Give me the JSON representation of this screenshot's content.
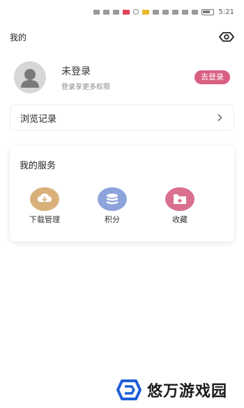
{
  "status_bar": {
    "time": "5:21"
  },
  "header": {
    "title": "我的",
    "eye_icon": "eye-icon"
  },
  "profile": {
    "name": "未登录",
    "subtitle": "登录享更多权限",
    "login_label": "去登录",
    "avatar_icon": "user-avatar-icon"
  },
  "history": {
    "label": "浏览记录",
    "chevron_icon": "chevron-right-icon"
  },
  "services": {
    "title": "我的服务",
    "items": [
      {
        "label": "下载管理",
        "icon": "cloud-download-icon",
        "color": "#d9b07a"
      },
      {
        "label": "积分",
        "icon": "coins-stack-icon",
        "color": "#8da3dc"
      },
      {
        "label": "收藏",
        "icon": "folder-star-icon",
        "color": "#d9708e"
      }
    ]
  },
  "colors": {
    "accent_pink": "#d95f82",
    "download_color": "#d9b07a",
    "points_color": "#8da3dc",
    "favorites_color": "#d9708e"
  },
  "watermark": {
    "text": "悠万游戏园",
    "logo_color": "#1f5fd6"
  }
}
